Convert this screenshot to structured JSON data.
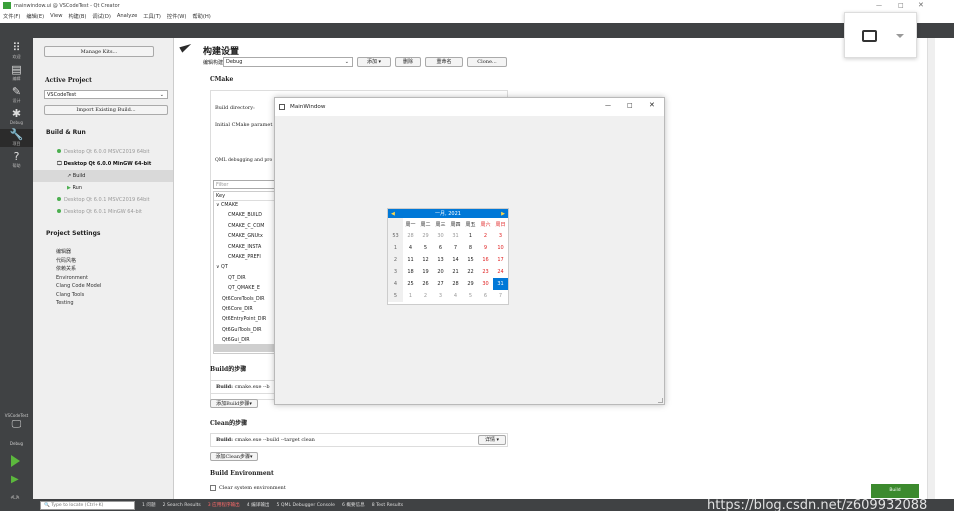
{
  "window": {
    "title": "mainwindow.ui @ VSCodeTest - Qt Creator",
    "controls": [
      "—",
      "□",
      "✕"
    ]
  },
  "menu": [
    "文件(F)",
    "编辑(E)",
    "View",
    "构建(B)",
    "调试(D)",
    "Analyze",
    "工具(T)",
    "控件(W)",
    "帮助(H)"
  ],
  "modes": [
    {
      "label": "欢迎",
      "icon": "welcome-icon"
    },
    {
      "label": "编辑",
      "icon": "edit-icon"
    },
    {
      "label": "设计",
      "icon": "design-icon"
    },
    {
      "label": "Debug",
      "icon": "debug-icon"
    },
    {
      "label": "项目",
      "icon": "projects-icon"
    },
    {
      "label": "帮助",
      "icon": "help-icon"
    }
  ],
  "bottom_modes": {
    "project_label": "VSCodeTest",
    "kit_label": "Debug"
  },
  "panel": {
    "manage_kits": "Manage Kits...",
    "active_project_heading": "Active Project",
    "active_project_value": "VSCodeTest",
    "import_build": "Import Existing Build...",
    "build_run_heading": "Build & Run",
    "kits": [
      {
        "label": "Desktop Qt 6.0.0 MSVC2019 64bit",
        "active": false
      },
      {
        "label": "Desktop Qt 6.0.0 MinGW 64-bit",
        "active": true
      },
      {
        "label": "Build",
        "active": true,
        "sub": true
      },
      {
        "label": "Run",
        "active": false,
        "sub": true
      },
      {
        "label": "Desktop Qt 6.0.1 MSVC2019 64bit",
        "active": false
      },
      {
        "label": "Desktop Qt 6.0.1 MinGW 64-bit",
        "active": false
      }
    ],
    "project_settings_heading": "Project Settings",
    "settings": [
      "编辑器",
      "代码风格",
      "依赖关系",
      "Environment",
      "Clang Code Model",
      "Clang Tools",
      "Testing"
    ]
  },
  "content": {
    "title": "构建设置",
    "edit_config_label": "编辑构建配置:",
    "edit_config_value": "Debug",
    "add_btn": "添加",
    "delete_btn": "删除",
    "rename_btn": "重命名",
    "clone_btn": "Clone...",
    "cmake_heading": "CMake",
    "build_dir_label": "Build directory:",
    "initial_params_label": "Initial CMake paramet",
    "qml_debug_label": "QML debugging and pro",
    "filter_placeholder": "Filter",
    "key_header": "Key",
    "tree": [
      {
        "t": "CMAKE",
        "lvl": 0,
        "exp": true
      },
      {
        "t": "CMAKE_BUILD",
        "lvl": 2
      },
      {
        "t": "CMAKE_C_COM",
        "lvl": 2
      },
      {
        "t": "CMAKE_GNUtx",
        "lvl": 2
      },
      {
        "t": "CMAKE_INSTA",
        "lvl": 2
      },
      {
        "t": "CMAKE_PREFI",
        "lvl": 2
      },
      {
        "t": "QT",
        "lvl": 0,
        "exp": true
      },
      {
        "t": "QT_DIR",
        "lvl": 2
      },
      {
        "t": "QT_QMAKE_E",
        "lvl": 2
      },
      {
        "t": "Qt6CoreTools_DIR",
        "lvl": 1
      },
      {
        "t": "Qt6Core_DIR",
        "lvl": 1
      },
      {
        "t": "Qt6EntryPoint_DIR",
        "lvl": 1
      },
      {
        "t": "Qt6GuiTools_DIR",
        "lvl": 1
      },
      {
        "t": "Qt6Gui_DIR",
        "lvl": 1
      }
    ],
    "build_steps_heading": "Build的步骤",
    "build_step_label": "Build:",
    "build_step_value": "cmake.exe --b",
    "add_build_step": "添加Build步骤",
    "clean_steps_heading": "Clean的步骤",
    "clean_step_label": "Build:",
    "clean_step_value": "cmake.exe --build --target clean",
    "details_btn": "详情",
    "add_clean_step": "添加Clean步骤",
    "build_env_heading": "Build Environment",
    "clear_env": "Clear system environment"
  },
  "main_window": {
    "title": "MainWindow",
    "calendar": {
      "month_year": "一月, 2021",
      "weekdays": [
        "周一",
        "周二",
        "周三",
        "周四",
        "周五",
        "周六",
        "周日"
      ],
      "rows": [
        {
          "wk": "53",
          "days": [
            "28",
            "29",
            "30",
            "31",
            "1",
            "2",
            "3"
          ]
        },
        {
          "wk": "1",
          "days": [
            "4",
            "5",
            "6",
            "7",
            "8",
            "9",
            "10"
          ]
        },
        {
          "wk": "2",
          "days": [
            "11",
            "12",
            "13",
            "14",
            "15",
            "16",
            "17"
          ]
        },
        {
          "wk": "3",
          "days": [
            "18",
            "19",
            "20",
            "21",
            "22",
            "23",
            "24"
          ]
        },
        {
          "wk": "4",
          "days": [
            "25",
            "26",
            "27",
            "28",
            "29",
            "30",
            "31"
          ]
        },
        {
          "wk": "5",
          "days": [
            "1",
            "2",
            "3",
            "4",
            "5",
            "6",
            "7"
          ]
        }
      ],
      "selected": "31"
    }
  },
  "status": {
    "locate_placeholder": "Type to locate (Ctrl+K)",
    "tabs": [
      "1 问题",
      "2 Search Results",
      "3 应用程序输出",
      "4 编译输出",
      "5 QML Debugger Console",
      "6 概要信息",
      "8 Test Results"
    ],
    "watermark": "https://blog.csdn.net/z609932088"
  },
  "build_button": "Build"
}
